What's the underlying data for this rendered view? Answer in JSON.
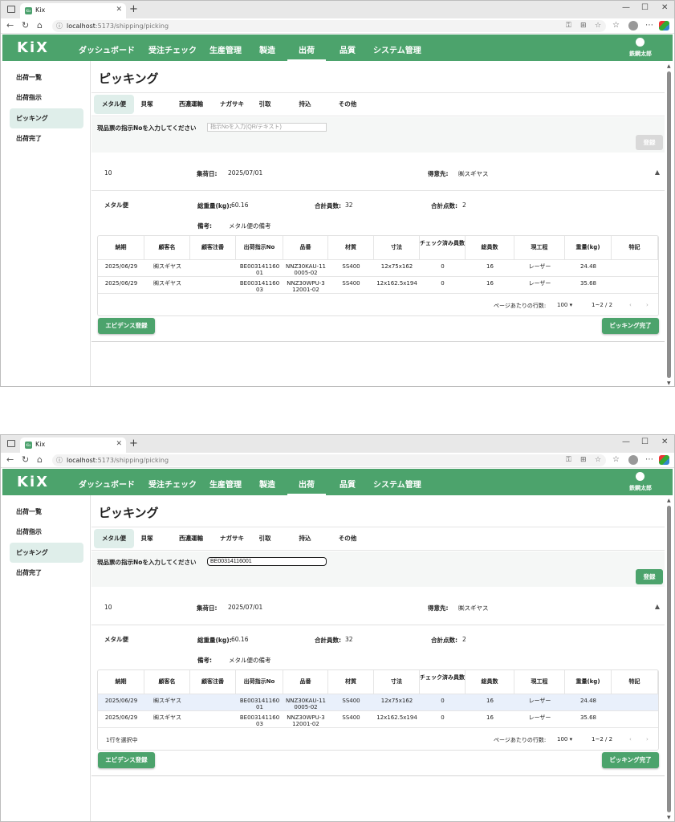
{
  "browser": {
    "tab_title": "Kix",
    "favicon_text": "Kix",
    "url_host": "localhost",
    "url_path": ":5173/shipping/picking"
  },
  "app": {
    "logo": "KiX",
    "accent_color": "#4ca36c",
    "nav": [
      "ダッシュボード",
      "受注チェック",
      "生産管理",
      "製造",
      "出荷",
      "品質",
      "システム管理"
    ],
    "active_nav": "出荷",
    "user_name": "鉄鋼太郎"
  },
  "sidebar": {
    "items": [
      "出荷一覧",
      "出荷指示",
      "ピッキング",
      "出荷完了"
    ],
    "active": "ピッキング"
  },
  "page": {
    "title": "ピッキング",
    "carrier_tabs": [
      "メタル便",
      "貝塚",
      "西濃運輸",
      "ナガサキ",
      "引取",
      "持込",
      "その他"
    ],
    "active_tab": "メタル便",
    "input_label": "現品票の指示Noを入力してください",
    "input_placeholder": "指示Noを入力(QR/テキスト)",
    "register_label": "登録"
  },
  "order": {
    "id": "10",
    "ship_date_label": "集荷日:",
    "ship_date": "2025/07/01",
    "customer_label": "得意先:",
    "customer": "㈱スギヤス",
    "collapse_icon": "chevron-up-icon",
    "carrier": "メタル便",
    "total_weight_label": "総重量(kg):",
    "total_weight": "60.16",
    "total_members_label": "合計員数:",
    "total_members": "32",
    "total_points_label": "合計点数:",
    "total_points": "2",
    "remarks_label": "備考:",
    "remarks": "メタル便の備考"
  },
  "table": {
    "columns": [
      "納期",
      "顧客名",
      "顧客注番",
      "出荷指示No",
      "品番",
      "材質",
      "寸法",
      "チェック済み員数",
      "総員数",
      "現工程",
      "重量(kg)",
      "特記"
    ],
    "rows": [
      {
        "due": "2025/06/29",
        "customer": "㈱スギヤス",
        "order_no": "",
        "instr": "BE00314116001",
        "part": "NNZ30KAU-110005-02",
        "material": "SS400",
        "size": "12x75x162",
        "checked": "0",
        "total": "16",
        "process": "レーザー",
        "weight": "24.48",
        "note": ""
      },
      {
        "due": "2025/06/29",
        "customer": "㈱スギヤス",
        "order_no": "",
        "instr": "BE00314116003",
        "part": "NNZ30WPU-312001-02",
        "material": "SS400",
        "size": "12x162.5x194",
        "checked": "0",
        "total": "16",
        "process": "レーザー",
        "weight": "35.68",
        "note": ""
      }
    ],
    "rows_per_page_label": "ページあたりの行数:",
    "rows_per_page": "100",
    "pagination": "1~2 / 2",
    "selected_text": "1行を選択中"
  },
  "buttons": {
    "evidence": "エビデンス登録",
    "complete": "ピッキング完了"
  },
  "state2": {
    "input_value": "BE00314116001",
    "selected_row": 0
  }
}
